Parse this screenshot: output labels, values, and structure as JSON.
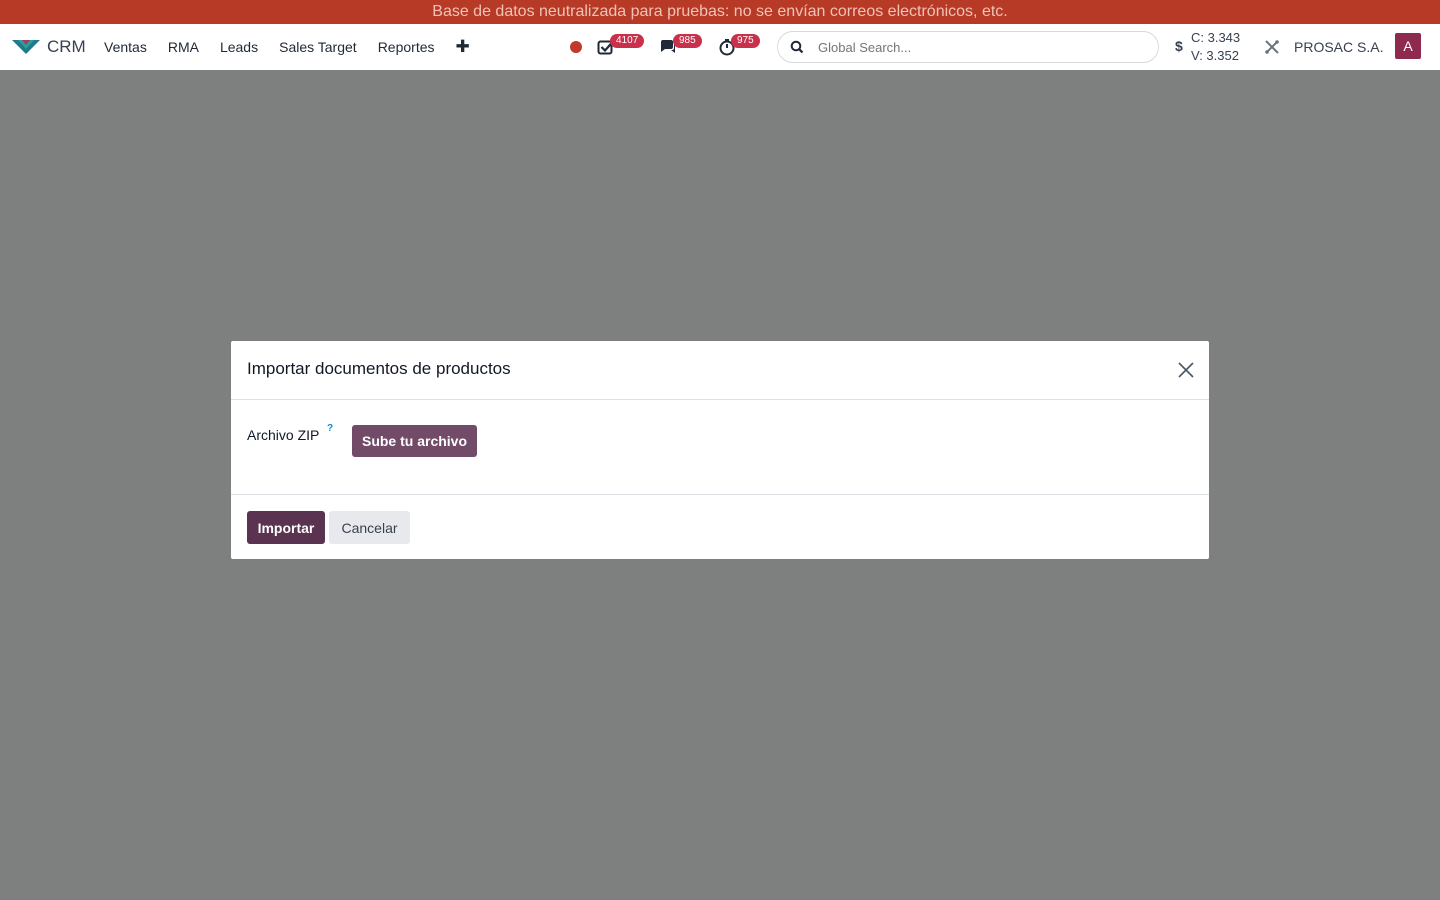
{
  "banner": {
    "text": "Base de datos neutralizada para pruebas: no se envían correos electrónicos, etc."
  },
  "navbar": {
    "app_name": "CRM",
    "menu": [
      "Ventas",
      "RMA",
      "Leads",
      "Sales Target",
      "Reportes"
    ],
    "add_symbol": "✚",
    "badges": {
      "activities": "4107",
      "messages": "985",
      "timers": "975"
    },
    "search_placeholder": "Global Search...",
    "currency_symbol": "$",
    "rate_buy": "C: 3.343",
    "rate_sell": "V: 3.352",
    "company": "PROSAC S.A.",
    "avatar_letter": "A"
  },
  "modal": {
    "title": "Importar documentos de productos",
    "field_label": "Archivo ZIP",
    "help_mark": "?",
    "upload_label": "Sube tu archivo",
    "import_label": "Importar",
    "cancel_label": "Cancelar"
  },
  "colors": {
    "banner_bg": "#b73a26",
    "backdrop": "#7e807f",
    "primary": "#5a3350",
    "upload": "#714b67",
    "badge": "#c9304b"
  }
}
